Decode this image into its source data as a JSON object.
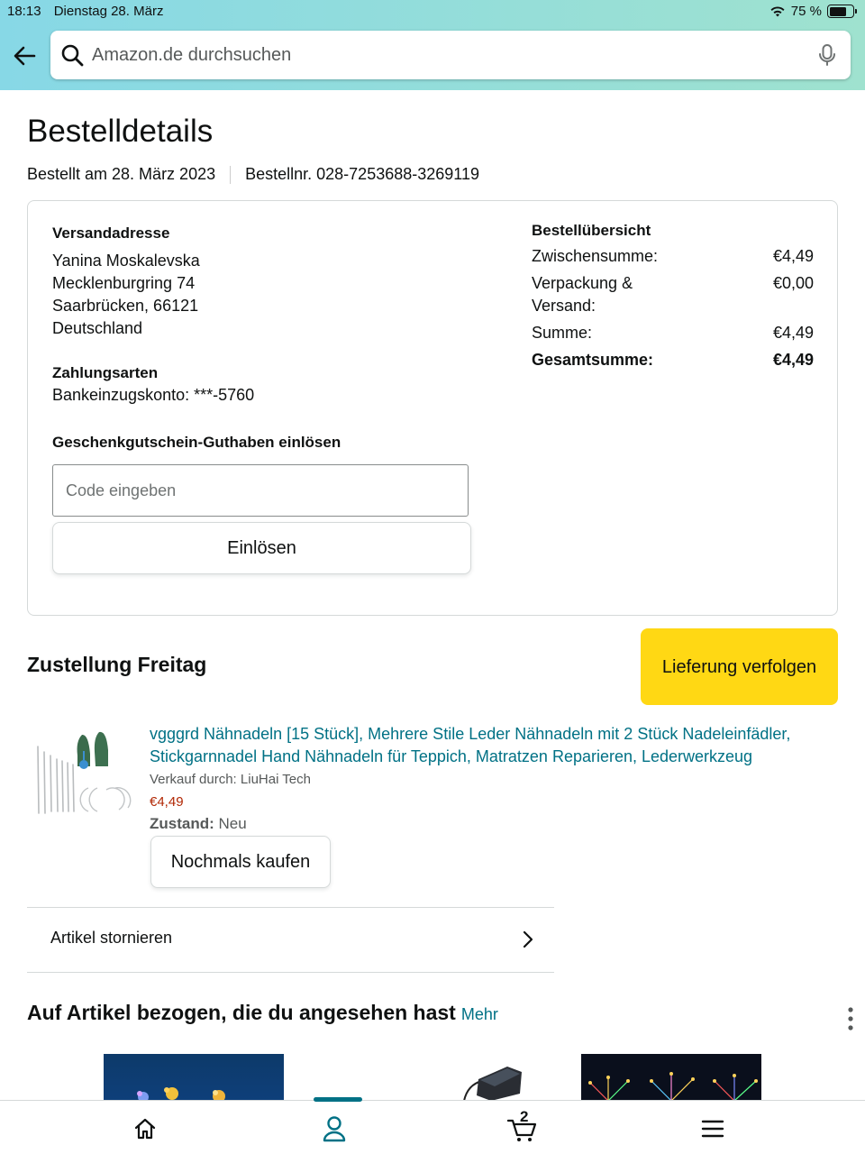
{
  "status_bar": {
    "time": "18:13",
    "date": "Dienstag 28. März",
    "battery": "75 %"
  },
  "search": {
    "placeholder": "Amazon.de durchsuchen"
  },
  "page": {
    "title": "Bestelldetails",
    "ordered_on": "Bestellt am 28. März 2023",
    "order_number": "Bestellnr. 028-7253688-3269119"
  },
  "shipping": {
    "heading": "Versandadresse",
    "name": "Yanina Moskalevska",
    "street": "Mecklenburgring 74",
    "city": "Saarbrücken, 66121",
    "country": "Deutschland"
  },
  "payment": {
    "heading": "Zahlungsarten",
    "method": "Bankeinzugskonto: ***-5760"
  },
  "gift_card": {
    "heading": "Geschenkgutschein-Guthaben einlösen",
    "placeholder": "Code eingeben",
    "button": "Einlösen"
  },
  "summary": {
    "heading": "Bestellübersicht",
    "rows": [
      {
        "label": "Zwischensumme:",
        "value": "€4,49"
      },
      {
        "label": "Verpackung & Versand:",
        "value": "€0,00"
      },
      {
        "label": "Summe:",
        "value": "€4,49"
      },
      {
        "label": "Gesamtsumme:",
        "value": "€4,49"
      }
    ]
  },
  "delivery": {
    "title": "Zustellung Freitag",
    "track_button": "Lieferung verfolgen"
  },
  "item": {
    "title": "vgggrd Nähnadeln [15 Stück], Mehrere Stile Leder Nähnadeln mit 2 Stück Nadeleinfädler, Stickgarnnadel Hand Nähnadeln für Teppich, Matratzen Reparieren, Lederwerkzeug",
    "seller": "Verkauf durch: LiuHai Tech",
    "price": "€4,49",
    "condition_label": "Zustand:",
    "condition_value": "Neu",
    "buy_again": "Nochmals kaufen"
  },
  "cancel": {
    "label": "Artikel stornieren"
  },
  "related": {
    "title": "Auf Artikel bezogen, die du angesehen hast",
    "more": "Mehr"
  },
  "bottom_nav": {
    "cart_count": "2",
    "accent": "#007185"
  },
  "colors": {
    "link": "#007185",
    "price": "#B12704",
    "track_button": "#FFD814"
  }
}
